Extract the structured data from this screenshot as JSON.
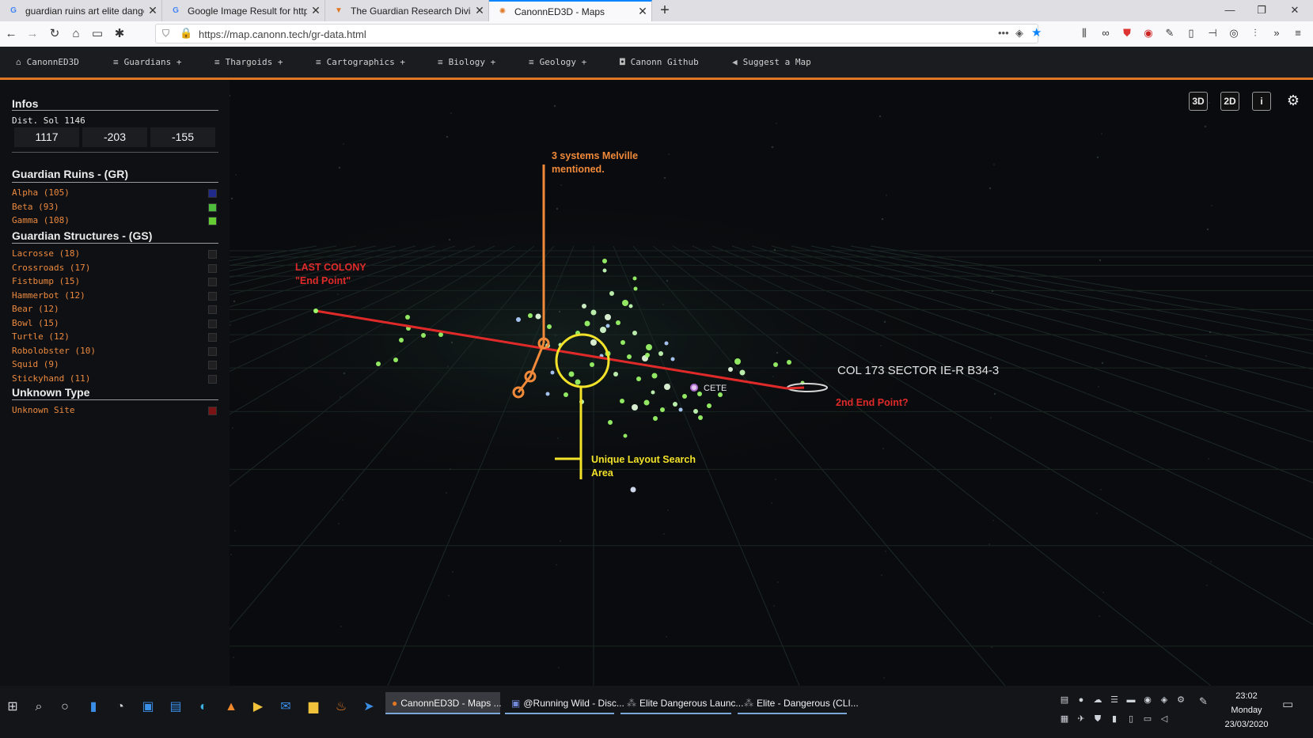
{
  "browser": {
    "tabs": [
      {
        "title": "guardian ruins art elite danger",
        "icon": "google-icon",
        "active": false
      },
      {
        "title": "Google Image Result for http://",
        "icon": "google-icon",
        "active": false
      },
      {
        "title": "The Guardian Research Division",
        "icon": "guardian-research-icon",
        "active": false
      },
      {
        "title": "CanonnED3D - Maps",
        "icon": "canonn-icon",
        "active": true
      }
    ],
    "new_tab": "+",
    "url": "https://map.canonn.tech/gr-data.html"
  },
  "site_menu": {
    "items": [
      {
        "label": "CanonnED3D",
        "icon": "home-icon"
      },
      {
        "label": "Guardians +",
        "icon": "menu-icon"
      },
      {
        "label": "Thargoids +",
        "icon": "menu-icon"
      },
      {
        "label": "Cartographics +",
        "icon": "menu-icon"
      },
      {
        "label": "Biology +",
        "icon": "menu-icon"
      },
      {
        "label": "Geology +",
        "icon": "menu-icon"
      },
      {
        "label": "Canonn Github",
        "icon": "github-icon"
      },
      {
        "label": "Suggest a Map",
        "icon": "megaphone-icon"
      }
    ]
  },
  "sidebar": {
    "infos": {
      "title": "Infos",
      "dist_label": "Dist. Sol 1146",
      "coords": [
        "1117",
        "-203",
        "-155"
      ]
    },
    "ruins": {
      "title": "Guardian Ruins - (GR)",
      "items": [
        {
          "label": "Alpha (105)",
          "color": "#1f2a8a"
        },
        {
          "label": "Beta (93)",
          "color": "#4dbb3c"
        },
        {
          "label": "Gamma (108)",
          "color": "#66cc33"
        }
      ]
    },
    "structures": {
      "title": "Guardian Structures - (GS)",
      "items": [
        {
          "label": "Lacrosse (18)",
          "color": "#1f1f22"
        },
        {
          "label": "Crossroads (17)",
          "color": "#1f1f22"
        },
        {
          "label": "Fistbump (15)",
          "color": "#1f1f22"
        },
        {
          "label": "Hammerbot (12)",
          "color": "#1f1f22"
        },
        {
          "label": "Bear (12)",
          "color": "#1f1f22"
        },
        {
          "label": "Bowl (15)",
          "color": "#1f1f22"
        },
        {
          "label": "Turtle (12)",
          "color": "#1f1f22"
        },
        {
          "label": "Robolobster (10)",
          "color": "#1f1f22"
        },
        {
          "label": "Squid (9)",
          "color": "#1f1f22"
        },
        {
          "label": "Stickyhand (11)",
          "color": "#1f1f22"
        }
      ]
    },
    "unknown": {
      "title": "Unknown Type",
      "items": [
        {
          "label": "Unknown Site",
          "color": "#7a1414"
        }
      ]
    }
  },
  "map": {
    "buttons": {
      "b3d": "3D",
      "b2d": "2D",
      "info": "i",
      "settings_icon": "gear-icon"
    },
    "annotations": {
      "melville_1": "3 systems Melville",
      "melville_2": "mentioned.",
      "last_colony_1": "LAST COLONY",
      "last_colony_2": "\"End Point\"",
      "col173": "COL 173 SECTOR IE-R B34-3",
      "end2": "2nd End Point?",
      "cete": "CETE",
      "unique_1": "Unique Layout Search",
      "unique_2": "Area"
    },
    "colors": {
      "red_line": "#e02a2a",
      "orange": "#f08a3a",
      "yellow": "#f2e22a",
      "green_star": "#9dfb6a"
    }
  },
  "taskbar": {
    "apps": [
      {
        "label": "CanonnED3D - Maps ...",
        "active": true
      },
      {
        "label": "@Running Wild - Disc...",
        "active": false
      },
      {
        "label": "Elite Dangerous Launc...",
        "active": false
      },
      {
        "label": "Elite - Dangerous (CLI...",
        "active": false
      }
    ],
    "clock": {
      "time": "23:02",
      "day": "Monday",
      "date": "23/03/2020"
    }
  }
}
